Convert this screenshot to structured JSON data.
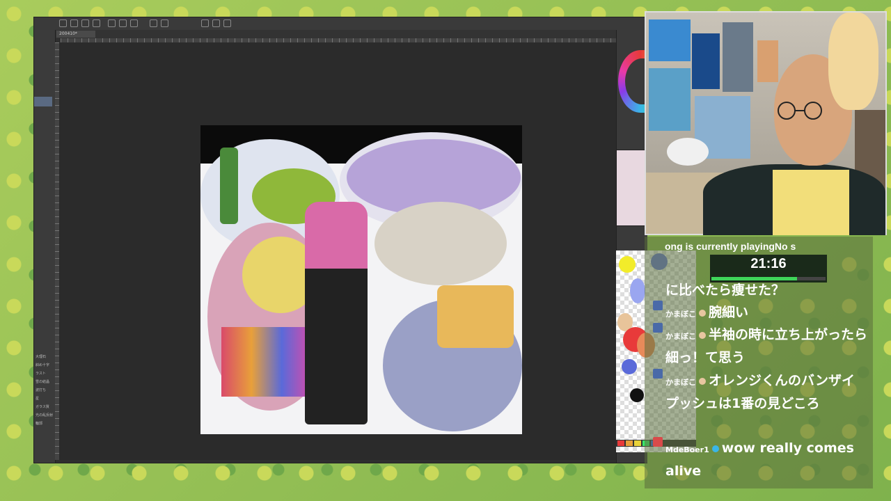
{
  "app": {
    "document_tab": "200410*"
  },
  "left_panel": {
    "labels": [
      "大理石",
      "斜め十字",
      "ラスト",
      "雪の結晶",
      "波打ち",
      "星",
      "ガラス質",
      "光の乱反射",
      "輪郭"
    ]
  },
  "stream": {
    "now_playing": "ong is currently playingNo s",
    "timer": "21:16",
    "timer_progress": 0.75
  },
  "chat": {
    "messages": [
      {
        "user": "",
        "text": "に比べたら痩せた？"
      },
      {
        "user": "かまぼこ",
        "text": "腕細い"
      },
      {
        "user": "かまぼこ",
        "text": "半袖の時に立ち上がったら細っ！て思う"
      },
      {
        "user": "かまぼこ",
        "text": "オレンジくんのバンザイプッシュは1番の見どころ"
      },
      {
        "user": "MdeBoer1",
        "text": "wow really comes alive"
      }
    ]
  },
  "colors": {
    "chat_bg": "#5a6e3c",
    "timer_fill": "#3fd65a",
    "app_bg": "#2f2f2f"
  }
}
